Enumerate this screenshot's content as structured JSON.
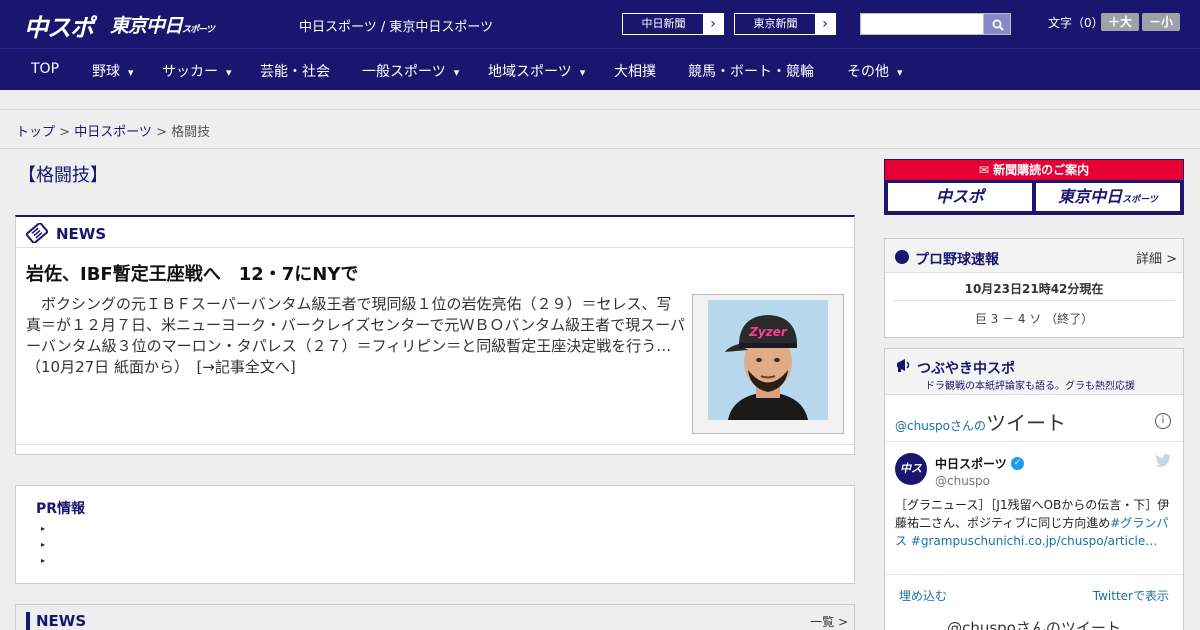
{
  "header": {
    "logo_chuspo": "中スポ",
    "logo_tokyo": "東京中日",
    "logo_tokyo_small": "スポーツ",
    "site_name": "中日スポーツ / 東京中日スポーツ",
    "paper_buttons": [
      "中日新聞",
      "東京新聞"
    ],
    "search_placeholder": "",
    "font_size_label": "文字（0）",
    "font_larger": "＋大",
    "font_smaller": "－小"
  },
  "nav": {
    "items": [
      {
        "label": "TOP",
        "has_menu": false
      },
      {
        "label": "野球",
        "has_menu": true
      },
      {
        "label": "サッカー",
        "has_menu": true
      },
      {
        "label": "芸能・社会",
        "has_menu": false
      },
      {
        "label": "一般スポーツ",
        "has_menu": true
      },
      {
        "label": "地域スポーツ",
        "has_menu": true
      },
      {
        "label": "大相撲",
        "has_menu": false
      },
      {
        "label": "競馬・ボート・競輪",
        "has_menu": false
      },
      {
        "label": "その他",
        "has_menu": true
      }
    ]
  },
  "breadcrumb": {
    "home": "トップ",
    "section": "中日スポーツ",
    "current": "格闘技",
    "sep": " > "
  },
  "page": {
    "title": "【格闘技】"
  },
  "news": {
    "heading": "NEWS",
    "headline": "岩佐、IBF暫定王座戦へ　12・7にNYで",
    "lead": "　ボクシングの元ＩＢＦスーパーバンタム級王者で現同級１位の岩佐亮佑（２９）＝セレス、写真＝が１２月７日、米ニューヨーク・バークレイズセンターで元ＷＢＯバンタム級王者で現スーパーバンタム級３位のマーロン・タパレス（２７）＝フィリピン＝と同級暫定王座決定戦を行う…（10月27日 紙面から）　",
    "read_more": "[→記事全文へ]",
    "photo_cap_text": "Zyzer"
  },
  "pr": {
    "heading": "PR情報",
    "bullets": [
      "▸",
      "▸",
      "▸"
    ]
  },
  "news2": {
    "heading": "NEWS",
    "more": "一覧 >"
  },
  "sidebar": {
    "subscribe": {
      "banner": "新聞購読のご案内",
      "left": "中スポ",
      "right": "東京中日",
      "right_small": "スポーツ"
    },
    "yakyu": {
      "title": "プロ野球速報",
      "detail": "詳細 >",
      "time": "10月23日21時42分現在",
      "score": "巨 3 － 4 ソ （終了）"
    },
    "tweets": {
      "title": "つぶやき中スポ",
      "subtitle": "ドラ観戦の本紙評論家も語る。グラも熱烈応援",
      "tl_prefix": "@chuspoさんの",
      "tl_title": "ツイート",
      "info": "i",
      "account_name": "中日スポーツ",
      "handle": "@chuspo",
      "avatar": "中スポ",
      "tweet_text": "［グラニュース］［J1残留へOBからの伝言・下］伊藤祐二さん、ポジティブに同じ方向進め",
      "tweet_tags": "#グランパス #grampuschunichi.co.jp/chuspo/article…",
      "embed": "埋め込む",
      "view_on_twitter": "Twitterで表示",
      "bottom": "@chuspoさんのツイート"
    }
  },
  "colors": {
    "brand": "#1a1670",
    "accent_red": "#e60033",
    "link": "#1b6fa8"
  }
}
